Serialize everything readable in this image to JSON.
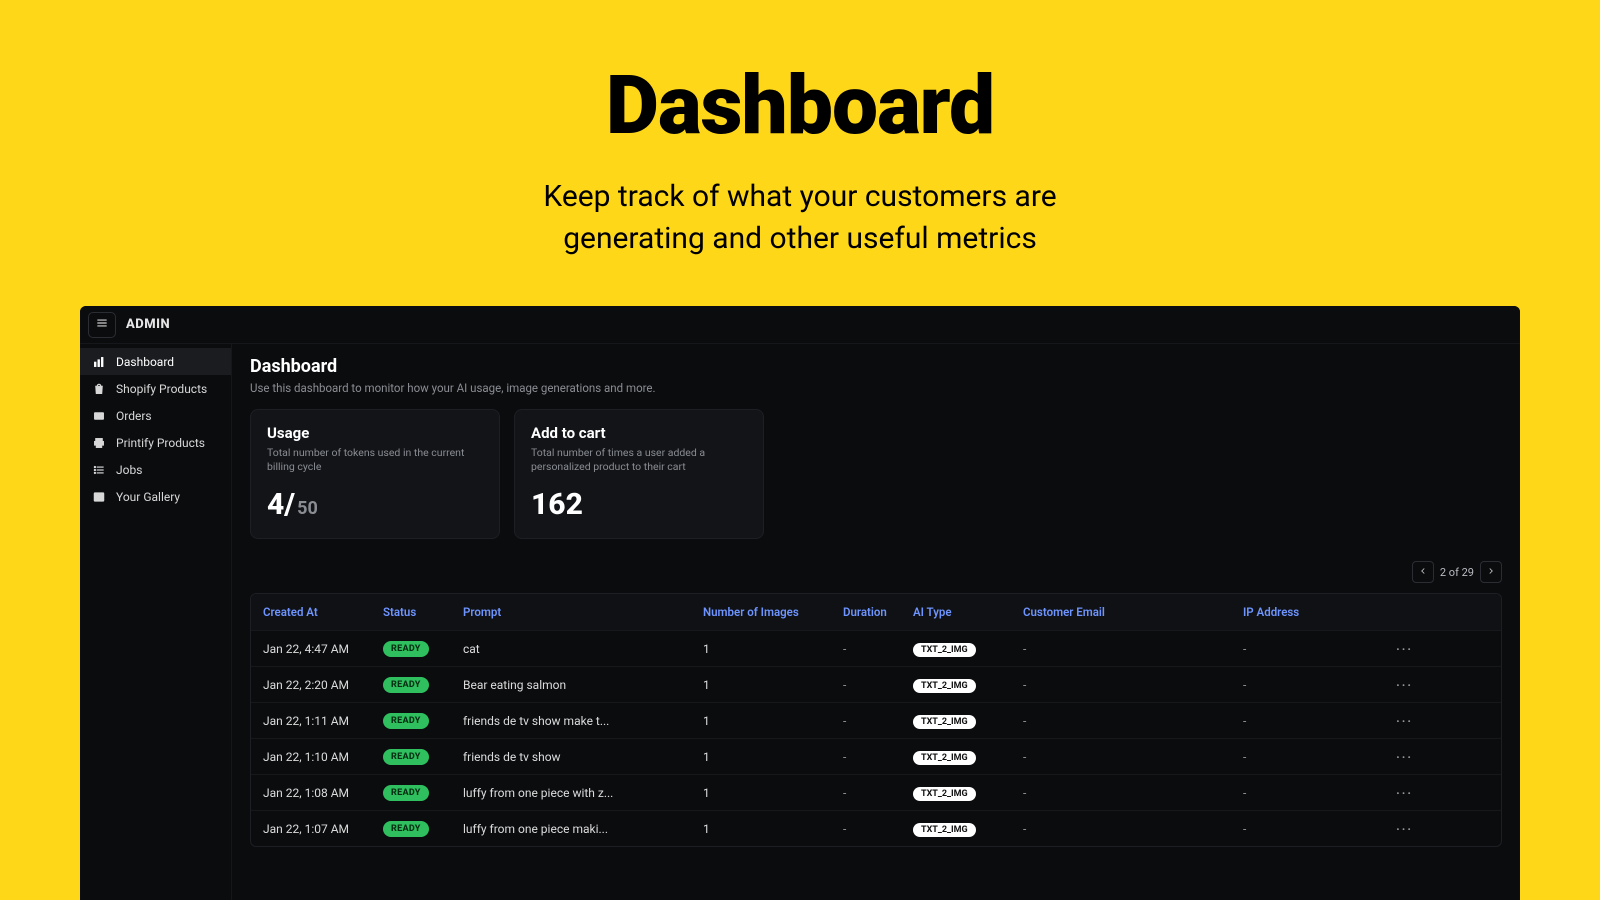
{
  "hero": {
    "title": "Dashboard",
    "subtitle_line1": "Keep track of what your customers are",
    "subtitle_line2": "generating and other useful metrics"
  },
  "topbar": {
    "brand": "ADMIN"
  },
  "sidebar": {
    "items": [
      {
        "label": "Dashboard",
        "icon": "bars-icon",
        "active": true
      },
      {
        "label": "Shopify Products",
        "icon": "bag-icon",
        "active": false
      },
      {
        "label": "Orders",
        "icon": "box-icon",
        "active": false
      },
      {
        "label": "Printify Products",
        "icon": "print-icon",
        "active": false
      },
      {
        "label": "Jobs",
        "icon": "list-icon",
        "active": false
      },
      {
        "label": "Your Gallery",
        "icon": "image-icon",
        "active": false
      }
    ]
  },
  "page": {
    "title": "Dashboard",
    "subtitle": "Use this dashboard to monitor how your AI usage, image generations and more."
  },
  "cards": {
    "usage": {
      "title": "Usage",
      "subtitle": "Total number of tokens used in the current billing cycle",
      "value": "4/",
      "denom": "50"
    },
    "addtocart": {
      "title": "Add to cart",
      "subtitle": "Total number of times a user added a personalized product to their cart",
      "value": "162"
    }
  },
  "pager": {
    "text": "2 of 29"
  },
  "table": {
    "columns": [
      "Created At",
      "Status",
      "Prompt",
      "Number of Images",
      "Duration",
      "AI Type",
      "Customer Email",
      "IP Address",
      ""
    ],
    "rows": [
      {
        "created_at": "Jan 22, 4:47 AM",
        "status": "READY",
        "prompt": "cat",
        "num_images": "1",
        "duration": "-",
        "ai_type": "TXT_2_IMG",
        "email": "-",
        "ip": "-"
      },
      {
        "created_at": "Jan 22, 2:20 AM",
        "status": "READY",
        "prompt": "Bear eating salmon",
        "num_images": "1",
        "duration": "-",
        "ai_type": "TXT_2_IMG",
        "email": "-",
        "ip": "-"
      },
      {
        "created_at": "Jan 22, 1:11 AM",
        "status": "READY",
        "prompt": "friends de tv show make t...",
        "num_images": "1",
        "duration": "-",
        "ai_type": "TXT_2_IMG",
        "email": "-",
        "ip": "-"
      },
      {
        "created_at": "Jan 22, 1:10 AM",
        "status": "READY",
        "prompt": "friends de tv show",
        "num_images": "1",
        "duration": "-",
        "ai_type": "TXT_2_IMG",
        "email": "-",
        "ip": "-"
      },
      {
        "created_at": "Jan 22, 1:08 AM",
        "status": "READY",
        "prompt": "luffy from one piece with z...",
        "num_images": "1",
        "duration": "-",
        "ai_type": "TXT_2_IMG",
        "email": "-",
        "ip": "-"
      },
      {
        "created_at": "Jan 22, 1:07 AM",
        "status": "READY",
        "prompt": "luffy from one piece maki...",
        "num_images": "1",
        "duration": "-",
        "ai_type": "TXT_2_IMG",
        "email": "-",
        "ip": "-"
      }
    ]
  },
  "glyphs": {
    "dots": "···"
  }
}
